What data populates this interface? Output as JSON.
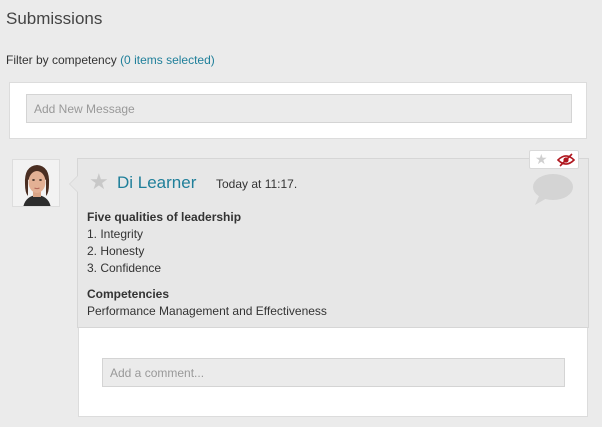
{
  "page": {
    "title": "Submissions"
  },
  "filter": {
    "label": "Filter by competency",
    "link_text": "(0 items selected)"
  },
  "new_message": {
    "placeholder": "Add New Message"
  },
  "post": {
    "author": "Di Learner",
    "timestamp": "Today at 11:17.",
    "heading": "Five qualities of leadership",
    "items": [
      "1. Integrity",
      "2. Honesty",
      "3. Confidence"
    ],
    "competencies_label": "Competencies",
    "competencies_value": "Performance Management and Effectiveness",
    "icons": {
      "favorite": "star-icon",
      "action_star": "star-icon",
      "visibility": "hidden-eye-icon",
      "comment": "comment-bubble-icon"
    }
  },
  "comment": {
    "placeholder": "Add a comment..."
  },
  "colors": {
    "link": "#1f7f9a",
    "eye_icon": "#b0171f",
    "background": "#ebebeb"
  }
}
